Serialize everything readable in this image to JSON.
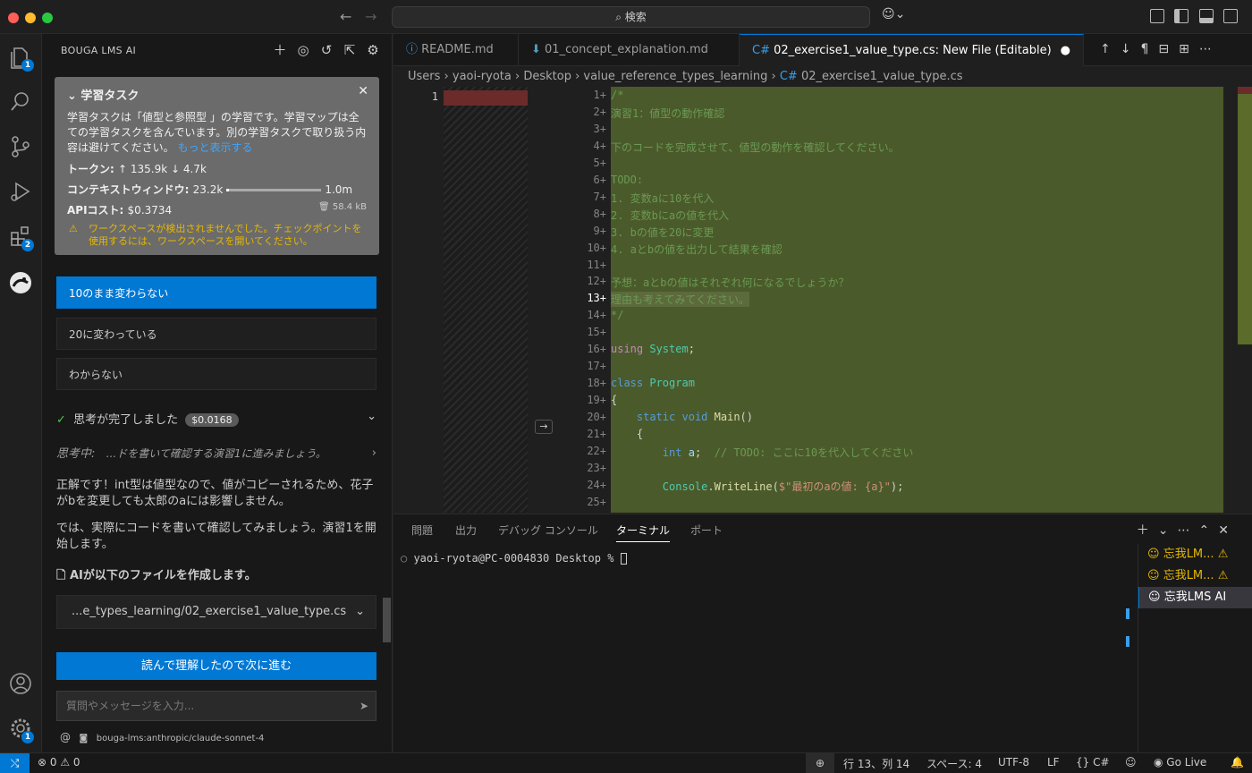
{
  "window": {
    "search": "検索"
  },
  "sidebar": {
    "title": "BOUGA LMS AI",
    "task": {
      "heading": "学習タスク",
      "body": "学習タスクは「値型と参照型 」の学習です。学習マップは全ての学習タスクを含んでいます。別の学習タスクで取り扱う内容は避けてください。",
      "more": "もっと表示する",
      "tokens_label": "トークン:",
      "tokens_value": "↑ 135.9k ↓ 4.7k",
      "context_label": "コンテキストウィンドウ:",
      "context_used": "23.2k",
      "context_max": "1.0m",
      "context_fraction": 0.023,
      "api_label": "APIコスト:",
      "api_value": "$0.3734",
      "size": "58.4 kB",
      "warning": "ワークスペースが検出されませんでした。チェックポイントを使用するには、ワークスペースを開いてください。"
    },
    "options": [
      "10のまま変わらない",
      "20に変わっている",
      "わからない"
    ],
    "thinking": {
      "label": "思考が完了しました",
      "cost": "$0.0168",
      "sub_label": "思考中:",
      "sub_text": "...ドを書いて確認する演習1に進みましょう。"
    },
    "answer1": "正解です！int型は値型なので、値がコピーされるため、花子がbを変更しても太郎のaには影響しません。",
    "answer2": "では、実際にコードを書いて確認してみましょう。演習1を開始します。",
    "file_heading": "AIが以下のファイルを作成します。",
    "file_path": "...e_types_learning/02_exercise1_value_type.cs",
    "next_button": "読んで理解したので次に進む",
    "input_placeholder": "質問やメッセージを入力...",
    "model": "bouga-lms:anthropic/claude-sonnet-4"
  },
  "activity": {
    "explorer_badge": "1",
    "extensions_badge": "2",
    "settings_badge": "1"
  },
  "tabs": [
    {
      "label": "README.md"
    },
    {
      "label": "01_concept_explanation.md"
    },
    {
      "label": "02_exercise1_value_type.cs: New File (Editable)"
    }
  ],
  "breadcrumb": [
    "Users",
    "yaoi-ryota",
    "Desktop",
    "value_reference_types_learning",
    "02_exercise1_value_type.cs"
  ],
  "editor": {
    "left_line": "1",
    "line_numbers": [
      "1",
      "2",
      "3",
      "4",
      "5",
      "6",
      "7",
      "8",
      "9",
      "10",
      "11",
      "12",
      "13",
      "14",
      "15",
      "16",
      "17",
      "18",
      "19",
      "20",
      "21",
      "22",
      "23",
      "24",
      "25"
    ],
    "lines": [
      "/*",
      "演習1：値型の動作確認",
      "",
      "下のコードを完成させて、値型の動作を確認してください。",
      "",
      "TODO:",
      "1. 変数aに10を代入",
      "2. 変数bにaの値を代入",
      "3. bの値を20に変更",
      "4. aとbの値を出力して結果を確認",
      "",
      "予想：aとbの値はそれぞれ何になるでしょうか？",
      "理由も考えてみてください。",
      "*/",
      "",
      "using System;",
      "",
      "class Program",
      "{",
      "    static void Main()",
      "    {",
      "        int a;  // TODO: ここに10を代入してください",
      "",
      "        Console.WriteLine($\"最初のaの値: {a}\");",
      ""
    ]
  },
  "panel": {
    "tabs": [
      "問題",
      "出力",
      "デバッグ コンソール",
      "ターミナル",
      "ポート"
    ],
    "prompt": "yaoi-ryota@PC-0004830 Desktop % ",
    "terminals": [
      "忘我LM...",
      "忘我LM...",
      "忘我LMS AI"
    ]
  },
  "status": {
    "errors": "0",
    "warnings": "0",
    "position": "行 13、列 14",
    "spaces": "スペース: 4",
    "encoding": "UTF-8",
    "eol": "LF",
    "language": "C#",
    "golive": "Go Live"
  }
}
